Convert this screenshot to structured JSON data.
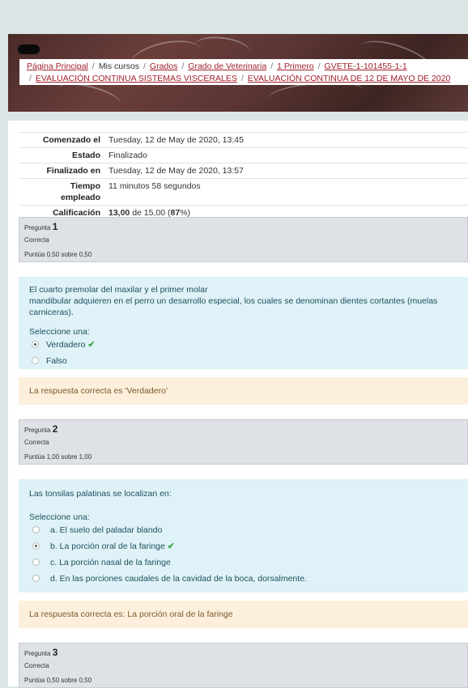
{
  "breadcrumb": [
    {
      "label": "Página Principal",
      "link": true
    },
    {
      "label": "Mis cursos",
      "link": false
    },
    {
      "label": "Grados",
      "link": true
    },
    {
      "label": "Grado de Veterinaria",
      "link": true
    },
    {
      "label": "1 Primero",
      "link": true
    },
    {
      "label": "GVETE-1-101455-1-1",
      "link": true
    },
    {
      "label": "EVALUACIÓN CONTINUA SISTEMAS VISCERALES",
      "link": true
    },
    {
      "label": "EVALUACIÓN CONTINUA DE 12 DE MAYO DE 2020",
      "link": true
    }
  ],
  "summary": {
    "started_label": "Comenzado el",
    "started_value": "Tuesday, 12 de May de 2020, 13:45",
    "state_label": "Estado",
    "state_value": "Finalizado",
    "finished_label": "Finalizado en",
    "finished_value": "Tuesday, 12 de May de 2020, 13:57",
    "time_label_1": "Tiempo",
    "time_label_2": "empleado",
    "time_value": "11 minutos 58 segundos",
    "grade_label": "Calificación",
    "grade_score": "13,00",
    "grade_mid": "de 15,00 (",
    "grade_pct": "87",
    "grade_end": "%)"
  },
  "questions": [
    {
      "label": "Pregunta",
      "number": "1",
      "state": "Correcta",
      "grade": "Puntúa 0,50 sobre 0,50",
      "text_line1": "El cuarto premolar del maxilar y el primer molar",
      "text_line2": "mandibular adquieren en el perro un desarrollo especial, los cuales se denominan dientes cortantes (muelas carniceras).",
      "prompt": "Seleccione una:",
      "options": [
        {
          "label": "Verdadero",
          "selected": true,
          "correct_mark": "✔"
        },
        {
          "label": "Falso",
          "selected": false
        }
      ],
      "feedback": "La respuesta correcta es 'Verdadero'"
    },
    {
      "label": "Pregunta",
      "number": "2",
      "state": "Correcta",
      "grade": "Puntúa 1,00 sobre 1,00",
      "text_line1": "Las tonsilas palatinas se localizan en:",
      "prompt": "Seleccione una:",
      "options": [
        {
          "label": "a. El suelo del paladar blando",
          "selected": false
        },
        {
          "label": "b. La porción oral de la faringe",
          "selected": true,
          "correct_mark": "✔"
        },
        {
          "label": "c. La porción nasal de la faringe",
          "selected": false
        },
        {
          "label": "d. En las porciones caudales de la cavidad de la boca, dorsalmente.",
          "selected": false
        }
      ],
      "feedback": "La respuesta correcta es: La porción oral de la faringe"
    },
    {
      "label": "Pregunta",
      "number": "3",
      "state": "Correcta",
      "grade": "Puntúa 0,50 sobre 0,50"
    }
  ],
  "colors": {
    "link": "#a11f2a",
    "question_bg": "#def2f8",
    "feedback_bg": "#fcefdc",
    "info_bg": "#dee2e6",
    "check": "#3ca53c"
  }
}
